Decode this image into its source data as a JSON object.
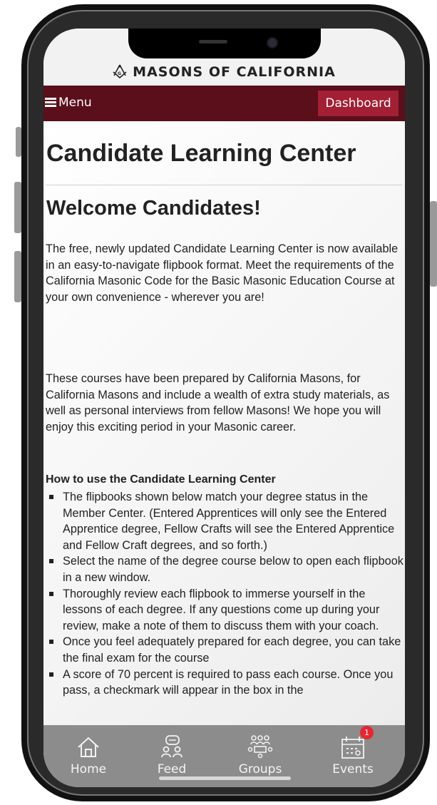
{
  "brand": {
    "title": "MASONS OF CALIFORNIA"
  },
  "nav": {
    "menu_label": "Menu",
    "dashboard_label": "Dashboard"
  },
  "page": {
    "title": "Candidate Learning Center",
    "welcome": "Welcome Candidates!",
    "paragraphs": [
      "The free, newly updated Candidate Learning Center is now available in an easy-to-navigate flipbook format. Meet the requirements of the California Masonic Code for the Basic Masonic Education Course at your own convenience - wherever you are!",
      "These courses have been prepared by California Masons, for California Masons and include a wealth of extra study materials, as well as personal interviews from fellow Masons! We hope you will enjoy this exciting period in your Masonic career."
    ],
    "howto_heading": "How to use the Candidate Learning Center",
    "howto_items": [
      "The flipbooks shown below match your degree status in the Member Center. (Entered Apprentices will only see the Entered Apprentice degree, Fellow Crafts will see the Entered Apprentice and Fellow Craft degrees, and so forth.)",
      "Select the name of the degree course below to open each flipbook in a new window.",
      "Thoroughly review each flipbook to immerse yourself in the lessons of each degree. If any questions come up during your review, make a note of them to discuss them with your coach.",
      "Once you feel adequately prepared for each degree, you can take the final exam for the course",
      "A score of 70 percent is required to pass each course. Once you pass, a checkmark will appear in the box in the"
    ]
  },
  "tabs": [
    {
      "label": "Home",
      "icon": "home-icon"
    },
    {
      "label": "Feed",
      "icon": "feed-icon"
    },
    {
      "label": "Groups",
      "icon": "groups-icon"
    },
    {
      "label": "Events",
      "icon": "events-icon",
      "badge": "1"
    }
  ],
  "colors": {
    "menu_bar": "#5a0f1b",
    "dashboard_button": "#a31f34",
    "tab_bar": "#8c8c8c",
    "badge": "#e8262f"
  }
}
